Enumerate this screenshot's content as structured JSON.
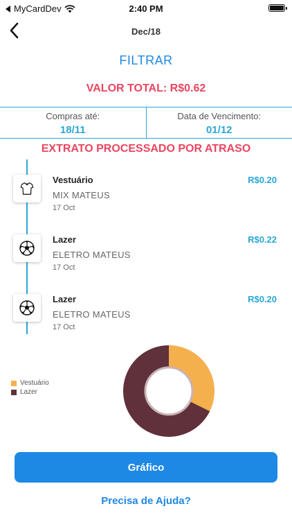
{
  "status_bar": {
    "carrier": "MyCardDev",
    "time": "2:40 PM"
  },
  "nav": {
    "title": "Dec/18"
  },
  "filter_label": "FILTRAR",
  "total_label": "VALOR TOTAL: R$0.62",
  "dates": {
    "purchases_label": "Compras até:",
    "purchases_value": "18/11",
    "due_label": "Data de Vencimento:",
    "due_value": "01/12"
  },
  "status_message": "EXTRATO PROCESSADO POR ATRASO",
  "transactions": [
    {
      "category": "Vestuário",
      "merchant": "MIX MATEUS",
      "date": "17 Oct",
      "amount": "R$0.20",
      "icon": "shirt-icon"
    },
    {
      "category": "Lazer",
      "merchant": "ELETRO MATEUS",
      "date": "17 Oct",
      "amount": "R$0.22",
      "icon": "soccer-ball-icon"
    },
    {
      "category": "Lazer",
      "merchant": "ELETRO MATEUS",
      "date": "17 Oct",
      "amount": "R$0.20",
      "icon": "soccer-ball-icon"
    }
  ],
  "chart_data": {
    "type": "pie",
    "categories": [
      "Vestuário",
      "Lazer"
    ],
    "values": [
      0.2,
      0.42
    ],
    "colors": [
      "#f5b04e",
      "#60313a"
    ],
    "legend_position": "left"
  },
  "graph_button": "Gráfico",
  "help_link": "Precisa de Ajuda?"
}
